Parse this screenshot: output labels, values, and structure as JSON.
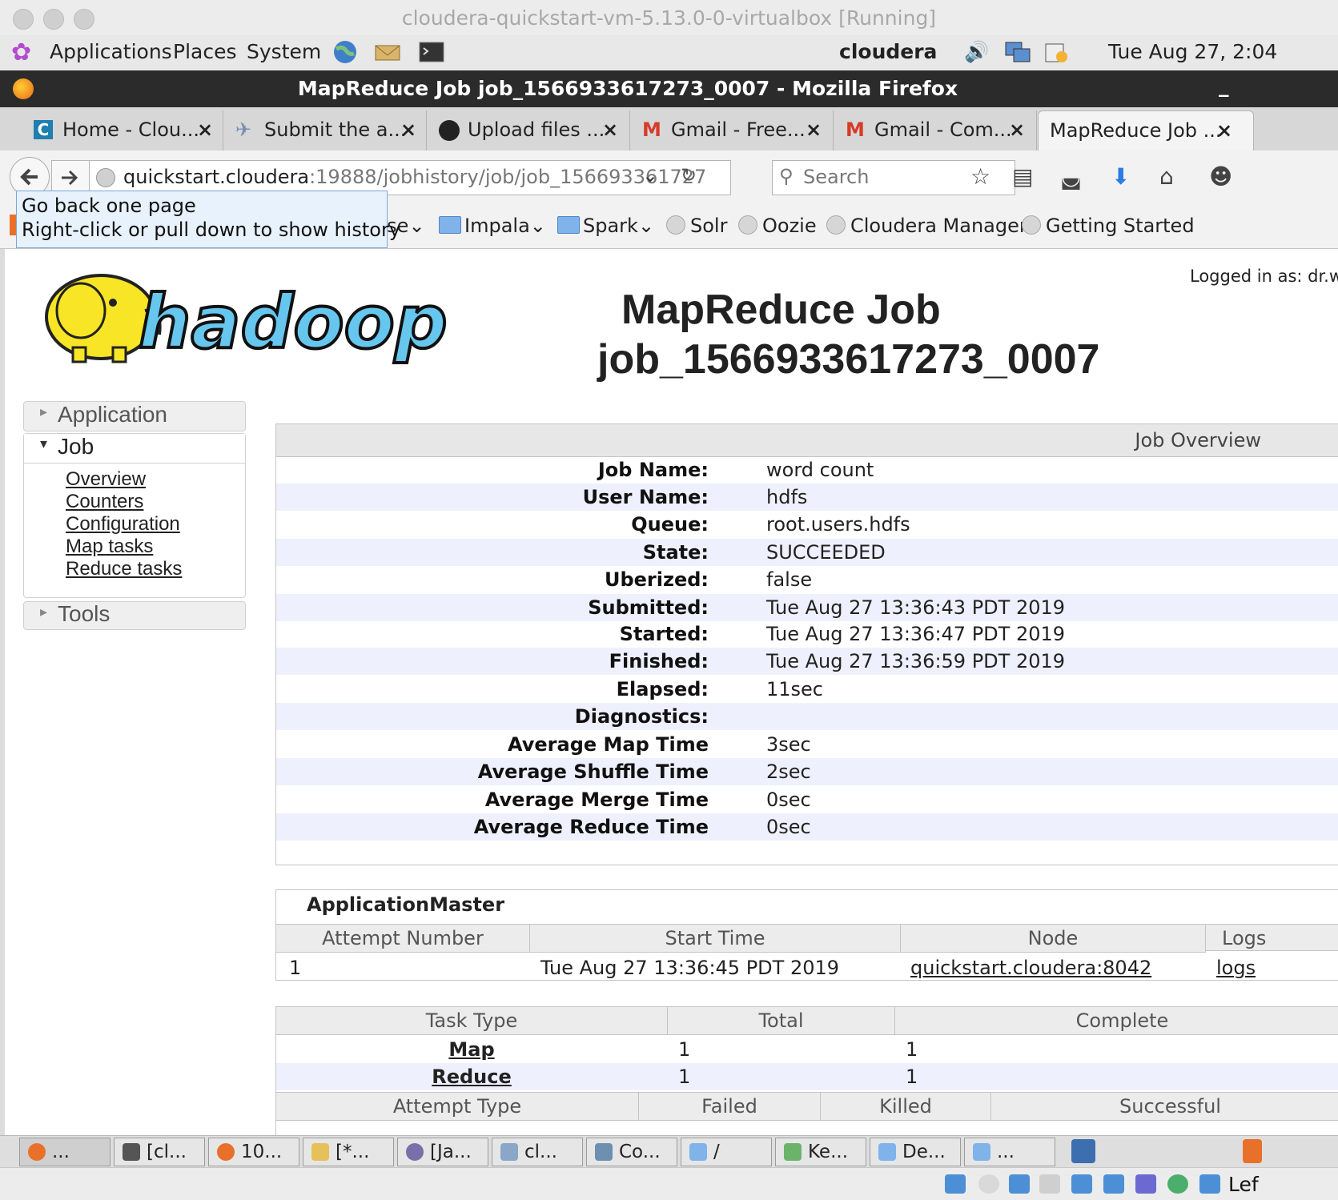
{
  "vm": {
    "title": "cloudera-quickstart-vm-5.13.0-0-virtualbox [Running]"
  },
  "gnome": {
    "menus": [
      "Applications",
      "Places",
      "System"
    ],
    "hostname": "cloudera",
    "clock": "Tue Aug 27,  2:04"
  },
  "firefox": {
    "title": "MapReduce Job job_1566933617273_0007 - Mozilla Firefox",
    "minimize": "_"
  },
  "tabs": [
    {
      "label": "Home - Clou...",
      "icon": "cloudera-icon"
    },
    {
      "label": "Submit the a...",
      "icon": "plane-icon"
    },
    {
      "label": "Upload files ...",
      "icon": "github-icon"
    },
    {
      "label": "Gmail - Free...",
      "icon": "gmail-icon"
    },
    {
      "label": "Gmail - Com...",
      "icon": "gmail-icon"
    },
    {
      "label": "MapReduce Job ...",
      "icon": "none"
    }
  ],
  "nav": {
    "url_host": "quickstart.cloudera",
    "url_path": ":19888/jobhistory/job/job_156693361727",
    "search_placeholder": "Search"
  },
  "tooltip": {
    "line1": "Go back one page",
    "line2": "Right-click or pull down to show history"
  },
  "bookmarks": [
    {
      "label": "Base",
      "kind": "folder-dropdown"
    },
    {
      "label": "Impala",
      "kind": "folder-dropdown"
    },
    {
      "label": "Spark",
      "kind": "folder-dropdown"
    },
    {
      "label": "Solr",
      "kind": "link"
    },
    {
      "label": "Oozie",
      "kind": "link"
    },
    {
      "label": "Cloudera Manager",
      "kind": "link"
    },
    {
      "label": "Getting Started",
      "kind": "link"
    }
  ],
  "page": {
    "logged_in": "Logged in as: dr.wh",
    "logo_text": "hadoop",
    "title_line1": "MapReduce Job",
    "title_line2": "job_1566933617273_0007"
  },
  "sidebar": {
    "application": "Application",
    "job": "Job",
    "job_links": [
      "Overview",
      "Counters",
      "Configuration",
      "Map tasks",
      "Reduce tasks"
    ],
    "tools": "Tools"
  },
  "overview": {
    "header": "Job Overview",
    "rows": [
      {
        "label": "Job Name:",
        "value": "word count"
      },
      {
        "label": "User Name:",
        "value": "hdfs"
      },
      {
        "label": "Queue:",
        "value": "root.users.hdfs"
      },
      {
        "label": "State:",
        "value": "SUCCEEDED"
      },
      {
        "label": "Uberized:",
        "value": "false"
      },
      {
        "label": "Submitted:",
        "value": "Tue Aug 27 13:36:43 PDT 2019"
      },
      {
        "label": "Started:",
        "value": "Tue Aug 27 13:36:47 PDT 2019"
      },
      {
        "label": "Finished:",
        "value": "Tue Aug 27 13:36:59 PDT 2019"
      },
      {
        "label": "Elapsed:",
        "value": "11sec"
      },
      {
        "label": "Diagnostics:",
        "value": ""
      },
      {
        "label": "Average Map Time",
        "value": "3sec"
      },
      {
        "label": "Average Shuffle Time",
        "value": "2sec"
      },
      {
        "label": "Average Merge Time",
        "value": "0sec"
      },
      {
        "label": "Average Reduce Time",
        "value": "0sec"
      }
    ]
  },
  "app_master": {
    "title": "ApplicationMaster",
    "headers": [
      "Attempt Number",
      "Start Time",
      "Node",
      "Logs"
    ],
    "row": {
      "attempt": "1",
      "start": "Tue Aug 27 13:36:45 PDT 2019",
      "node": "quickstart.cloudera:8042",
      "logs": "logs"
    }
  },
  "tasks": {
    "headers": [
      "Task Type",
      "Total",
      "Complete"
    ],
    "rows": [
      {
        "type": "Map",
        "total": "1",
        "complete": "1"
      },
      {
        "type": "Reduce",
        "total": "1",
        "complete": "1"
      }
    ],
    "attempt_headers": [
      "Attempt Type",
      "Failed",
      "Killed",
      "Successful"
    ]
  },
  "taskbar": {
    "items": [
      "...",
      "[cl...",
      "10...",
      "[*...",
      "[Ja...",
      "cl...",
      "Co...",
      "/",
      "Ke...",
      "De...",
      "..."
    ]
  },
  "vmstatus": {
    "host_key": "Lef"
  },
  "colors": {
    "hadoop_yellow": "#f7e526",
    "hadoop_blue": "#66c6ee",
    "row_alt": "#eef1fd"
  }
}
